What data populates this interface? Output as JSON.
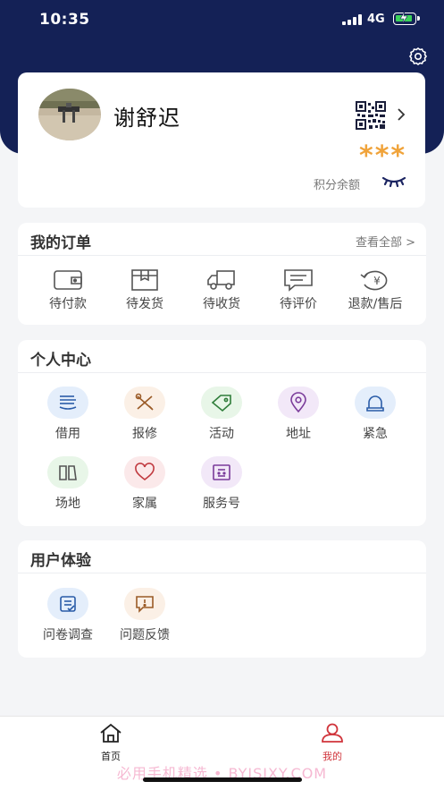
{
  "status_bar": {
    "time": "10:35",
    "network": "4G"
  },
  "profile": {
    "username": "谢舒迟",
    "points_mask": "***",
    "points_label": "积分余额"
  },
  "orders": {
    "title": "我的订单",
    "view_all": "查看全部 >",
    "items": [
      {
        "label": "待付款",
        "icon": "wallet-icon"
      },
      {
        "label": "待发货",
        "icon": "package-icon"
      },
      {
        "label": "待收货",
        "icon": "truck-icon"
      },
      {
        "label": "待评价",
        "icon": "comment-icon"
      },
      {
        "label": "退款/售后",
        "icon": "refund-icon"
      }
    ]
  },
  "personal": {
    "title": "个人中心",
    "items": [
      {
        "label": "借用",
        "icon": "borrow-icon"
      },
      {
        "label": "报修",
        "icon": "repair-icon"
      },
      {
        "label": "活动",
        "icon": "tag-icon"
      },
      {
        "label": "地址",
        "icon": "location-icon"
      },
      {
        "label": "紧急",
        "icon": "alarm-icon"
      },
      {
        "label": "场地",
        "icon": "venue-icon"
      },
      {
        "label": "家属",
        "icon": "heart-icon"
      },
      {
        "label": "服务号",
        "icon": "service-icon"
      }
    ]
  },
  "experience": {
    "title": "用户体验",
    "items": [
      {
        "label": "问卷调查",
        "icon": "survey-icon"
      },
      {
        "label": "问题反馈",
        "icon": "feedback-icon"
      }
    ]
  },
  "tabbar": {
    "items": [
      {
        "label": "首页",
        "icon": "home-icon",
        "active": false
      },
      {
        "label": "我的",
        "icon": "user-icon",
        "active": true
      }
    ]
  },
  "watermark": "必用手机精选 • BYJSJXY.COM",
  "colors": {
    "header": "#142156",
    "accent_red": "#d0343b",
    "star": "#f0a33a"
  }
}
